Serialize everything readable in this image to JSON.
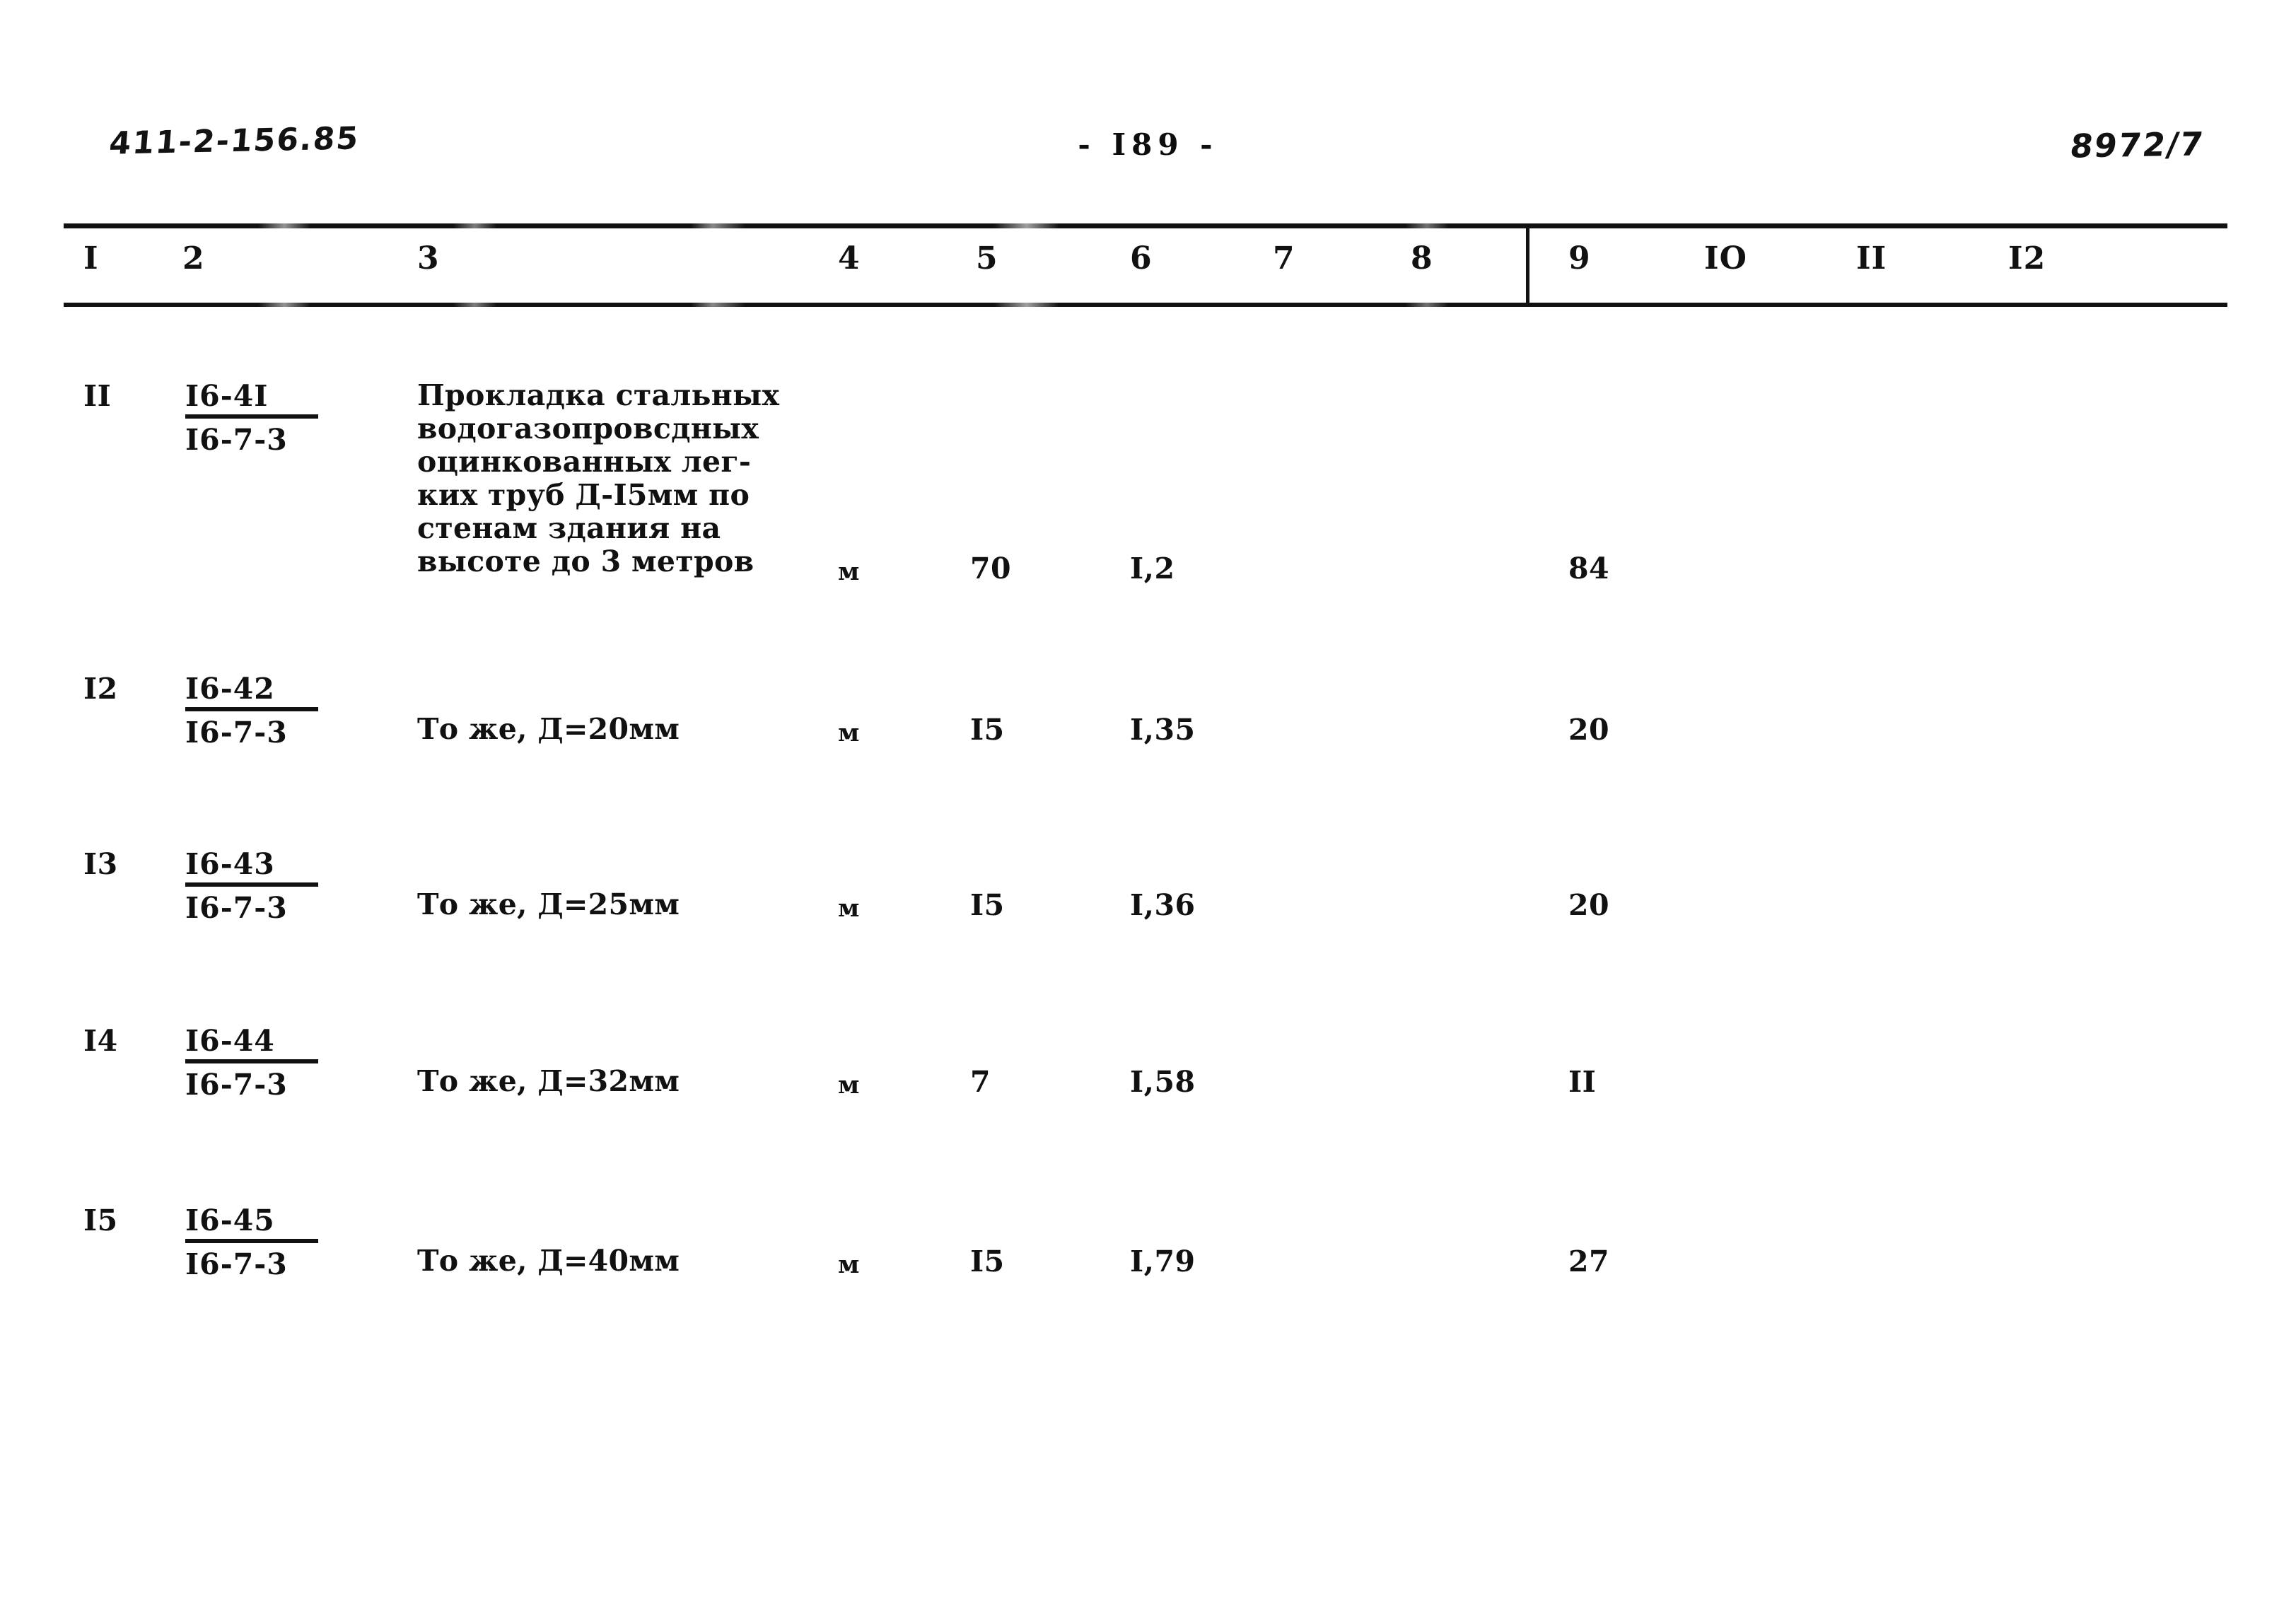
{
  "header": {
    "doc_number": "411-2-156.85",
    "page_number": "- I89 -",
    "sheet_number": "8972/7"
  },
  "table": {
    "column_headers": [
      "I",
      "2",
      "3",
      "4",
      "5",
      "6",
      "7",
      "8",
      "9",
      "IO",
      "II",
      "I2"
    ],
    "rows": [
      {
        "num": "II",
        "code_top": "I6-4I",
        "code_bottom": "I6-7-3",
        "description": "Прокладка стальных\nводогазопровсдных\nоцинкованных лег-\nких труб Д-I5мм по\nстенам здания на\nвысоте до 3 метров",
        "unit": "м",
        "qty": "70",
        "col6": "I,2",
        "col7": "",
        "col8": "",
        "col9": "84",
        "col10": "",
        "col11": "",
        "col12": ""
      },
      {
        "num": "I2",
        "code_top": "I6-42",
        "code_bottom": "I6-7-3",
        "description": "То же, Д=20мм",
        "unit": "м",
        "qty": "I5",
        "col6": "I,35",
        "col7": "",
        "col8": "",
        "col9": "20",
        "col10": "",
        "col11": "",
        "col12": ""
      },
      {
        "num": "I3",
        "code_top": "I6-43",
        "code_bottom": "I6-7-3",
        "description": "То же, Д=25мм",
        "unit": "м",
        "qty": "I5",
        "col6": "I,36",
        "col7": "",
        "col8": "",
        "col9": "20",
        "col10": "",
        "col11": "",
        "col12": ""
      },
      {
        "num": "I4",
        "code_top": "I6-44",
        "code_bottom": "I6-7-3",
        "description": "То же, Д=32мм",
        "unit": "м",
        "qty": "7",
        "col6": "I,58",
        "col7": "",
        "col8": "",
        "col9": "II",
        "col10": "",
        "col11": "",
        "col12": ""
      },
      {
        "num": "I5",
        "code_top": "I6-45",
        "code_bottom": "I6-7-3",
        "description": "То же, Д=40мм",
        "unit": "м",
        "qty": "I5",
        "col6": "I,79",
        "col7": "",
        "col8": "",
        "col9": "27",
        "col10": "",
        "col11": "",
        "col12": ""
      }
    ]
  }
}
